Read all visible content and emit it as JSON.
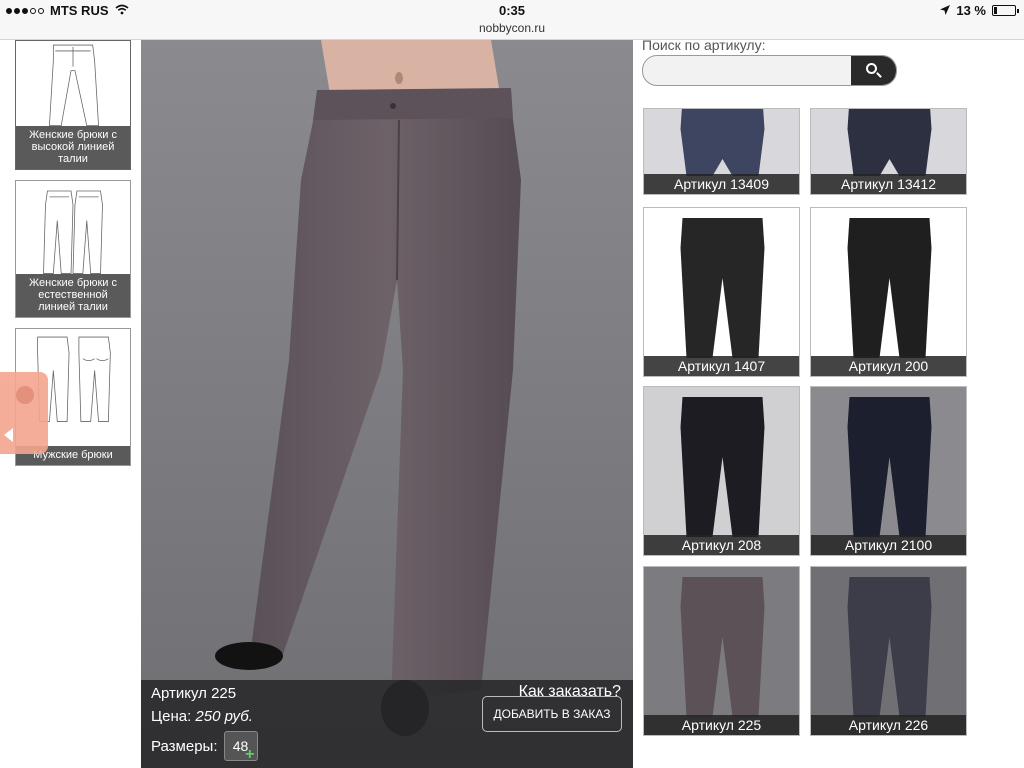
{
  "status_bar": {
    "carrier": "MTS RUS",
    "time": "0:35",
    "url": "nobbycon.ru",
    "battery": "13 %",
    "battery_level": 0.13
  },
  "sidebar": {
    "categories": [
      {
        "label": "Женские брюки с высокой линией талии"
      },
      {
        "label": "Женские брюки с естественной линией талии"
      },
      {
        "label": "Мужские брюки"
      }
    ]
  },
  "product": {
    "article": "Артикул 225",
    "price_label": "Цена:",
    "price": "250 руб.",
    "sizes_label": "Размеры:",
    "size": "48",
    "how_to_order": "Как заказать?",
    "add_button": "ДОБАВИТЬ В ЗАКАЗ"
  },
  "search": {
    "label": "Поиск по артикулу:",
    "placeholder": ""
  },
  "grid": [
    {
      "label": "Артикул 13409",
      "color": "#3d4560",
      "bg": "#d8d8dc"
    },
    {
      "label": "Артикул 13412",
      "color": "#2c3040",
      "bg": "#d8d8dc"
    },
    {
      "label": "Артикул 1407",
      "color": "#262626",
      "bg": "#ffffff"
    },
    {
      "label": "Артикул 200",
      "color": "#1f1f1f",
      "bg": "#ffffff"
    },
    {
      "label": "Артикул 208",
      "color": "#1c1c22",
      "bg": "#d0d0d3"
    },
    {
      "label": "Артикул 2100",
      "color": "#1b1f2e",
      "bg": "#8a8a8f"
    },
    {
      "label": "Артикул 225",
      "color": "#5b5156",
      "bg": "#7c7c80"
    },
    {
      "label": "Артикул 226",
      "color": "#3c3d48",
      "bg": "#6f6f74"
    }
  ]
}
